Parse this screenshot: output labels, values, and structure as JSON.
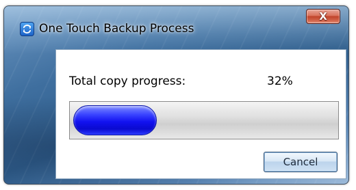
{
  "window": {
    "title": "One Touch Backup Process",
    "close_label": "X"
  },
  "progress": {
    "label": "Total copy progress:",
    "value_text": "32%",
    "fraction": 0.32
  },
  "buttons": {
    "cancel_label": "Cancel"
  }
}
